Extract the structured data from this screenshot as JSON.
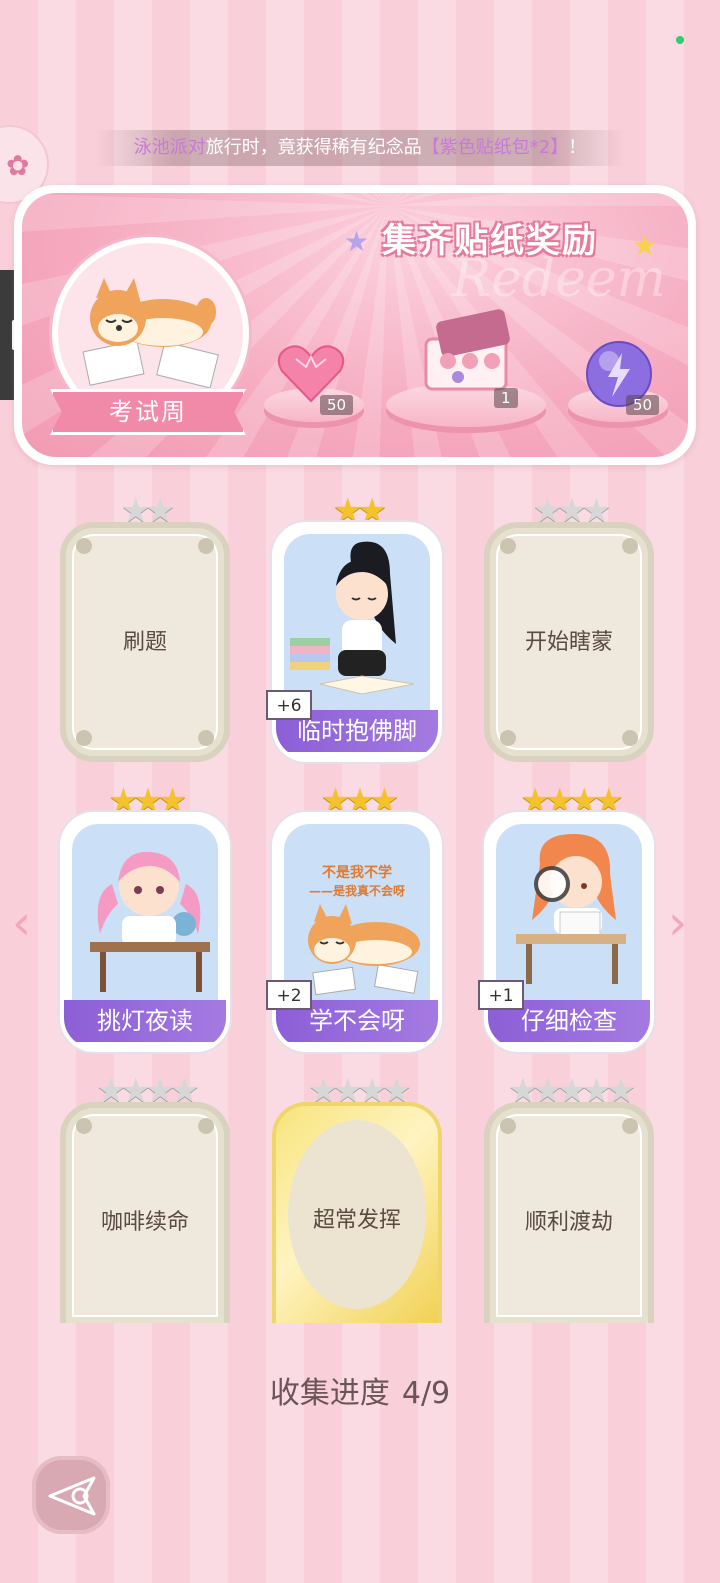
{
  "notice": {
    "part1": "泳池派对",
    "part2": "旅行时，竟获得稀有纪念品",
    "part3": "【紫色贴纸包*2】",
    "part4": "！"
  },
  "banner": {
    "title": "集齐贴纸奖励",
    "watermark": "Redeem",
    "theme_label": "考试周",
    "rewards": [
      {
        "icon": "pink-heart-gem-icon",
        "count": "50"
      },
      {
        "icon": "sticker-gift-box-icon",
        "count": "1"
      },
      {
        "icon": "purple-energy-orb-icon",
        "count": "50"
      }
    ]
  },
  "cards": [
    {
      "label": "刷题",
      "stars_filled": 0,
      "stars_total": 2,
      "state": "locked"
    },
    {
      "label": "临时抱佛脚",
      "stars_filled": 2,
      "stars_total": 2,
      "state": "collected",
      "badge": "+6"
    },
    {
      "label": "开始瞎蒙",
      "stars_filled": 0,
      "stars_total": 3,
      "state": "locked"
    },
    {
      "label": "挑灯夜读",
      "stars_filled": 3,
      "stars_total": 3,
      "state": "collected"
    },
    {
      "label": "学不会呀",
      "stars_filled": 3,
      "stars_total": 3,
      "state": "collected",
      "badge": "+2",
      "art_text_1": "不是我不学",
      "art_text_2": "——是我真不会呀"
    },
    {
      "label": "仔细检查",
      "stars_filled": 4,
      "stars_total": 4,
      "state": "collected",
      "badge": "+1"
    },
    {
      "label": "咖啡续命",
      "stars_filled": 0,
      "stars_total": 4,
      "state": "locked"
    },
    {
      "label": "超常发挥",
      "stars_filled": 0,
      "stars_total": 4,
      "state": "locked-gold"
    },
    {
      "label": "顺利渡劫",
      "stars_filled": 0,
      "stars_total": 5,
      "state": "locked"
    }
  ],
  "progress": {
    "label": "收集进度",
    "value": "4/9",
    "collected": 4,
    "total": 9
  },
  "colors": {
    "accent_pink": "#f08aa8",
    "label_purple": "#8b5ed6",
    "star_gold": "#f4c22d"
  }
}
